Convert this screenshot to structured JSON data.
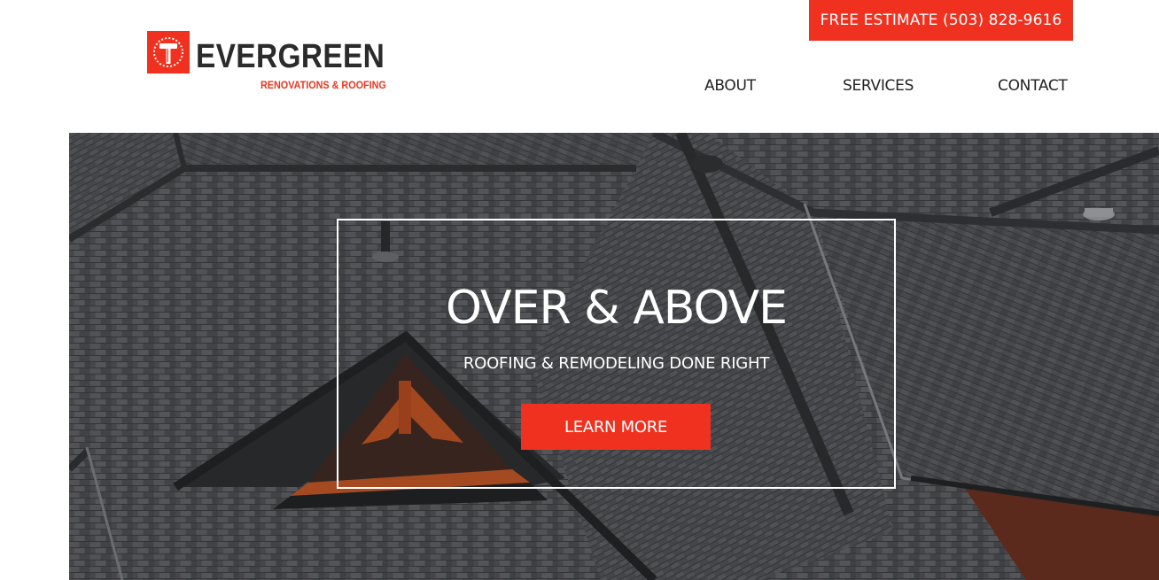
{
  "header": {
    "estimate_label": "FREE ESTIMATE (503) 828-9616",
    "logo": {
      "name": "EVERGREEN",
      "tagline": "RENOVATIONS & ROOFING",
      "icon": "hammer-icon"
    },
    "nav": [
      {
        "label": "ABOUT"
      },
      {
        "label": "SERVICES"
      },
      {
        "label": "CONTACT"
      }
    ]
  },
  "hero": {
    "title": "OVER & ABOVE",
    "subtitle": "ROOFING & REMODELING DONE RIGHT",
    "cta_label": "LEARN MORE",
    "background": "roof-shingles-photo"
  },
  "colors": {
    "accent": "#f0311f",
    "text_dark": "#222222",
    "hero_overlay": "#4a4b4f",
    "white": "#ffffff"
  }
}
